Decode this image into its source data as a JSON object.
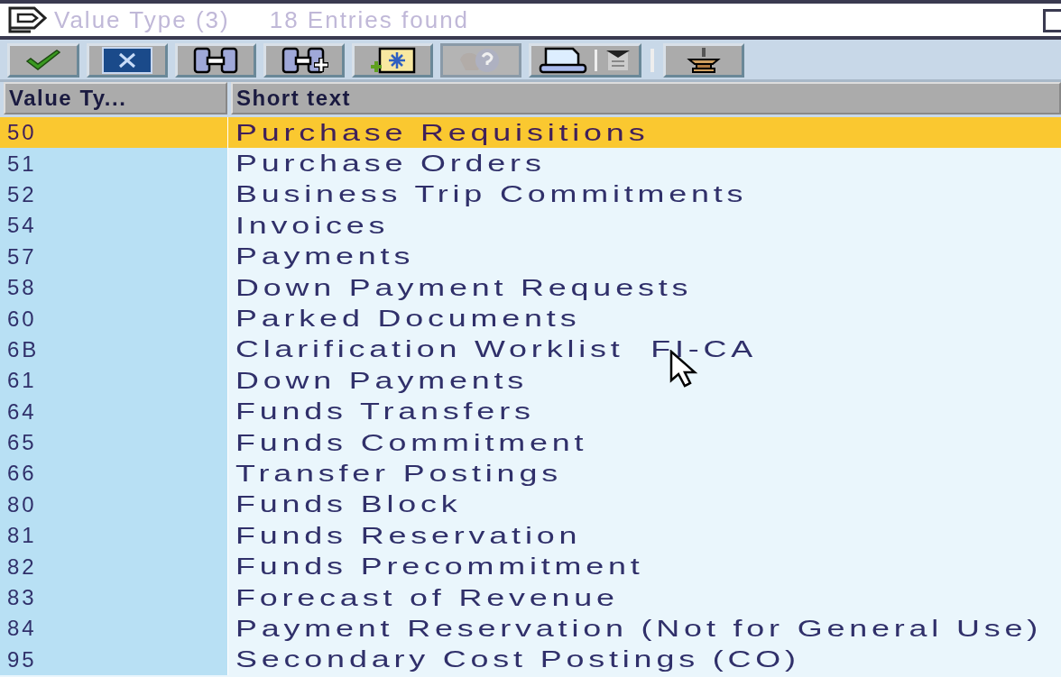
{
  "window": {
    "title": "Value Type (3)",
    "entries": "18 Entries found"
  },
  "toolbar": [
    {
      "kind": "check",
      "disabled": false
    },
    {
      "kind": "cancel",
      "disabled": false
    },
    {
      "kind": "find",
      "disabled": false
    },
    {
      "kind": "find-next",
      "disabled": false
    },
    {
      "kind": "new",
      "disabled": false
    },
    {
      "kind": "help",
      "disabled": true
    },
    {
      "kind": "print",
      "disabled": false
    },
    {
      "kind": "separator"
    },
    {
      "kind": "pin",
      "disabled": false
    }
  ],
  "table": {
    "columns": [
      "Value Ty...",
      "Short text"
    ],
    "rows": [
      {
        "code": "50",
        "text": "Purchase Requisitions",
        "selected": true
      },
      {
        "code": "51",
        "text": "Purchase Orders",
        "selected": false
      },
      {
        "code": "52",
        "text": "Business Trip Commitments",
        "selected": false
      },
      {
        "code": "54",
        "text": "Invoices",
        "selected": false
      },
      {
        "code": "57",
        "text": "Payments",
        "selected": false
      },
      {
        "code": "58",
        "text": "Down Payment Requests",
        "selected": false
      },
      {
        "code": "60",
        "text": "Parked Documents",
        "selected": false
      },
      {
        "code": "6B",
        "text": "Clarification Worklist  FI-CA",
        "selected": false
      },
      {
        "code": "61",
        "text": "Down Payments",
        "selected": false
      },
      {
        "code": "64",
        "text": "Funds Transfers",
        "selected": false
      },
      {
        "code": "65",
        "text": "Funds Commitment",
        "selected": false
      },
      {
        "code": "66",
        "text": "Transfer Postings",
        "selected": false
      },
      {
        "code": "80",
        "text": "Funds Block",
        "selected": false
      },
      {
        "code": "81",
        "text": "Funds Reservation",
        "selected": false
      },
      {
        "code": "82",
        "text": "Funds Precommitment",
        "selected": false
      },
      {
        "code": "83",
        "text": "Forecast of Revenue",
        "selected": false
      },
      {
        "code": "84",
        "text": "Payment Reservation (Not for General Use)",
        "selected": false
      },
      {
        "code": "95",
        "text": "Secondary Cost Postings (CO)",
        "selected": false
      }
    ]
  }
}
